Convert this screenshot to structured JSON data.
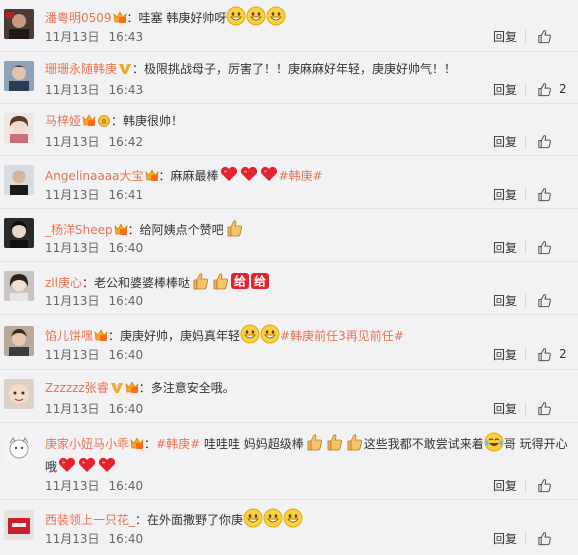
{
  "actions": {
    "reply_label": "回复",
    "like_icon": "thumb-up-icon"
  },
  "comments": [
    {
      "user": "潘粤明0509",
      "badge": "vip-crown",
      "pre": "：哇塞 韩庚好帅呀",
      "hashtag": "",
      "post": "",
      "emojis": [
        "grin",
        "grin",
        "grin"
      ],
      "date": "11月13日",
      "time": "16:43",
      "likes": ""
    },
    {
      "user": "珊珊永随韩庚",
      "badge": "verified-v",
      "pre": "：极限挑战母子，厉害了！！庚麻麻好年轻，庚庚好帅气！！",
      "hashtag": "",
      "post": "",
      "emojis": [],
      "date": "11月13日",
      "time": "16:43",
      "likes": "2"
    },
    {
      "user": "马梓娅",
      "badge": "vip-gold",
      "pre": "：韩庚很帅！",
      "hashtag": "",
      "post": "",
      "emojis": [],
      "date": "11月13日",
      "time": "16:42",
      "likes": ""
    },
    {
      "user": "Angelinaaaa大宝",
      "badge": "vip-crown",
      "pre": "：麻麻最棒",
      "hashtag": "#韩庚#",
      "post": "",
      "emojis": [
        "heart",
        "heart",
        "heart"
      ],
      "date": "11月13日",
      "time": "16:41",
      "likes": ""
    },
    {
      "user": "_杨洋Sheep",
      "badge": "vip-crown",
      "pre": "：给阿姨点个赞吧",
      "hashtag": "",
      "post": "",
      "emojis": [
        "thumb"
      ],
      "date": "11月13日",
      "time": "16:40",
      "likes": ""
    },
    {
      "user": "zll庚心",
      "badge": "",
      "pre": "：老公和婆婆棒棒哒",
      "hashtag": "",
      "post": "",
      "emojis": [
        "thumb",
        "thumb",
        "give",
        "give"
      ],
      "date": "11月13日",
      "time": "16:40",
      "likes": ""
    },
    {
      "user": "馅儿饼嘿",
      "badge": "vip-crown",
      "pre": "：庚庚好帅，庚妈真年轻",
      "hashtag": "#韩庚前任3再见前任#",
      "post": "",
      "emojis": [
        "grin",
        "grin"
      ],
      "date": "11月13日",
      "time": "16:40",
      "likes": "2"
    },
    {
      "user": "Zzzzzz张睿",
      "badge": "verified-v",
      "pre": "：多注意安全哦。",
      "hashtag": "",
      "post": "",
      "emojis": [],
      "date": "11月13日",
      "time": "16:40",
      "likes": ""
    },
    {
      "user": "庚家小妞马小乖",
      "badge": "vip-crown",
      "pre": "：",
      "hashtag": "#韩庚#",
      "post": " 哇哇哇 妈妈超级棒",
      "post2": "这些我都不敢尝试来着",
      "post3": "哥 玩得开心哦",
      "emojis": [
        "thumb",
        "thumb",
        "thumb",
        "laugh-cry",
        "heart",
        "heart",
        "heart"
      ],
      "date": "11月13日",
      "time": "16:40",
      "likes": ""
    },
    {
      "user": "西装领上一只花_",
      "badge": "",
      "pre": "：在外面撒野了你庚",
      "hashtag": "",
      "post": "",
      "emojis": [
        "grin",
        "grin",
        "grin"
      ],
      "date": "11月13日",
      "time": "16:40",
      "likes": ""
    }
  ],
  "colors": {
    "username": "#eb7350",
    "hashtag": "#eb7350",
    "background": "#f2f2f5",
    "text": "#333333",
    "meta": "#666666"
  }
}
